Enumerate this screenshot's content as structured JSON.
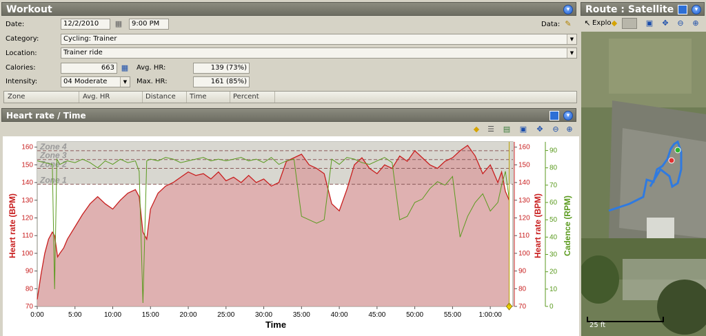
{
  "workout": {
    "title": "Workout",
    "date_label": "Date:",
    "date_value": "12/2/2010",
    "time_value": "9:00 PM",
    "data_label": "Data:",
    "category_label": "Category:",
    "category_value": "Cycling: Trainer",
    "location_label": "Location:",
    "location_value": "Trainer ride",
    "calories_label": "Calories:",
    "calories_value": "663",
    "avg_hr_label": "Avg. HR:",
    "avg_hr_value": "139 (73%)",
    "intensity_label": "Intensity:",
    "intensity_value": "04 Moderate",
    "max_hr_label": "Max. HR:",
    "max_hr_value": "161 (85%)",
    "table_columns": [
      "Zone",
      "Avg. HR",
      "Distance",
      "Time",
      "Percent"
    ]
  },
  "route": {
    "title": "Route : Satellite",
    "explore_label": "Explo",
    "scale_label": "25 ft"
  },
  "chart_panel": {
    "title": "Heart rate / Time"
  },
  "colors": {
    "hr": "#c81e1e",
    "cadence": "#5a9a1e",
    "hr_fill": "#d9a3a3",
    "zone_line": "#8a5a5a",
    "route": "#2f7ae0"
  },
  "chart_data": {
    "type": "line",
    "xlabel": "Time",
    "x_ticks": [
      "0:00",
      "5:00",
      "10:00",
      "15:00",
      "20:00",
      "25:00",
      "30:00",
      "35:00",
      "40:00",
      "45:00",
      "50:00",
      "55:00",
      "1:00:00"
    ],
    "ylabel_left": "Heart rate (BPM)",
    "ylabel_right_hr": "Heart rate (BPM)",
    "ylabel_right_cadence": "Cadence (RPM)",
    "ylim_hr": [
      70,
      163
    ],
    "ylim_cadence": [
      0,
      95
    ],
    "hr_ticks": [
      "70",
      "80",
      "90",
      "100",
      "110",
      "120",
      "130",
      "140",
      "150",
      "160"
    ],
    "cadence_ticks": [
      "0",
      "10",
      "20",
      "30",
      "40",
      "50",
      "60",
      "70",
      "80",
      "90"
    ],
    "xlim_min": [
      0,
      63
    ],
    "zones": [
      {
        "name": "Zone 4",
        "hr": 158
      },
      {
        "name": "Zone 3",
        "hr": 153
      },
      {
        "name": "Zone 2",
        "hr": 148
      },
      {
        "name": "Zone 1",
        "hr": 139
      }
    ],
    "series": [
      {
        "name": "Heart rate",
        "axis": "hr",
        "x": [
          0,
          0.5,
          1,
          1.5,
          2,
          2.3,
          2.7,
          3,
          3.5,
          4,
          5,
          6,
          7,
          8,
          9,
          10,
          11,
          12,
          13,
          13.5,
          14,
          14.5,
          15,
          16,
          17,
          18,
          19,
          20,
          21,
          22,
          23,
          24,
          25,
          26,
          27,
          28,
          29,
          30,
          31,
          32,
          33,
          34,
          35,
          36,
          37,
          38,
          39,
          40,
          41,
          42,
          43,
          44,
          45,
          46,
          47,
          48,
          49,
          50,
          51,
          52,
          53,
          54,
          55,
          56,
          57,
          58,
          59,
          60,
          61,
          61.5,
          62,
          62.5
        ],
        "y": [
          74,
          88,
          100,
          108,
          112,
          110,
          98,
          100,
          103,
          108,
          115,
          122,
          128,
          132,
          128,
          125,
          130,
          134,
          136,
          132,
          112,
          108,
          125,
          134,
          138,
          140,
          143,
          146,
          144,
          145,
          142,
          146,
          141,
          143,
          140,
          144,
          140,
          142,
          138,
          140,
          152,
          154,
          156,
          150,
          148,
          145,
          128,
          124,
          136,
          150,
          154,
          148,
          145,
          150,
          148,
          155,
          152,
          158,
          154,
          150,
          148,
          152,
          154,
          158,
          161,
          155,
          145,
          150,
          140,
          146,
          135,
          130
        ]
      },
      {
        "name": "Cadence",
        "axis": "cadence",
        "x": [
          0,
          1,
          2,
          2.3,
          2.6,
          3,
          4,
          5,
          6,
          7,
          8,
          9,
          10,
          11,
          12,
          13,
          13.5,
          14,
          14.5,
          15,
          16,
          17,
          18,
          19,
          20,
          21,
          22,
          23,
          24,
          25,
          26,
          27,
          28,
          29,
          30,
          31,
          32,
          33,
          34,
          35,
          36,
          37,
          38,
          39,
          40,
          41,
          42,
          43,
          44,
          45,
          46,
          47,
          48,
          49,
          50,
          51,
          52,
          53,
          54,
          55,
          56,
          57,
          58,
          59,
          60,
          61,
          61.5,
          62,
          62.5
        ],
        "y": [
          84,
          83,
          82,
          10,
          85,
          82,
          84,
          83,
          85,
          83,
          80,
          84,
          82,
          85,
          83,
          84,
          78,
          2,
          84,
          85,
          84,
          86,
          85,
          83,
          84,
          85,
          86,
          84,
          85,
          84,
          85,
          86,
          84,
          85,
          83,
          86,
          82,
          84,
          85,
          52,
          50,
          48,
          50,
          85,
          82,
          86,
          85,
          83,
          82,
          84,
          86,
          83,
          50,
          52,
          60,
          62,
          68,
          72,
          70,
          75,
          40,
          52,
          60,
          65,
          55,
          60,
          70,
          78,
          62
        ]
      }
    ]
  }
}
